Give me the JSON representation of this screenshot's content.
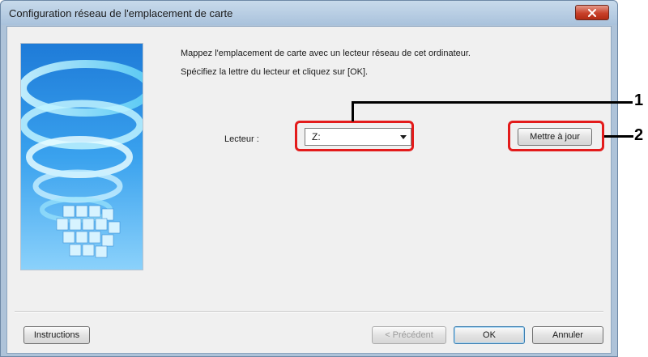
{
  "window": {
    "title": "Configuration réseau de l'emplacement de carte"
  },
  "content": {
    "message_line1": "Mappez l'emplacement de carte avec un lecteur réseau de cet ordinateur.",
    "message_line2": "Spécifiez la lettre du lecteur et cliquez sur [OK].",
    "drive_label": "Lecteur :",
    "drive_value": "Z:",
    "refresh_button": "Mettre à jour"
  },
  "footer": {
    "instructions_button": "Instructions",
    "back_button": "< Précédent",
    "ok_button": "OK",
    "cancel_button": "Annuler"
  },
  "callouts": [
    "1",
    "2"
  ],
  "colors": {
    "highlight": "#e31b1b",
    "titlebar": "#aec3d9",
    "close_button": "#c8412a"
  }
}
